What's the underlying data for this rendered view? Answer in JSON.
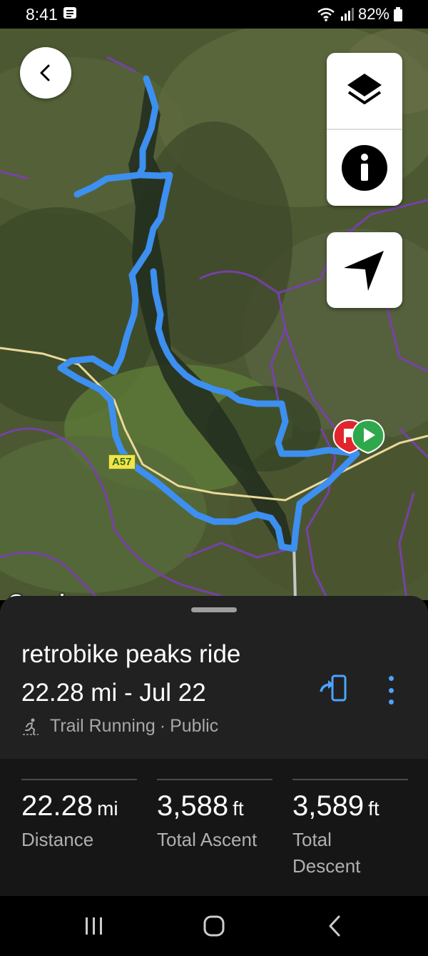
{
  "status_bar": {
    "time": "8:41",
    "battery": "82%"
  },
  "map": {
    "google_logo": "Google",
    "road_label": "A57",
    "route_color": "#3d8ff0",
    "boundary_color": "#7b3fb5"
  },
  "activity": {
    "title": "retrobike peaks ride",
    "subtitle": "22.28 mi - Jul 22",
    "type": "Trail Running",
    "separator": "·",
    "visibility": "Public"
  },
  "stats": [
    {
      "value": "22.28",
      "unit": "mi",
      "label": "Distance"
    },
    {
      "value": "3,588",
      "unit": "ft",
      "label": "Total Ascent"
    },
    {
      "value": "3,589",
      "unit": "ft",
      "label": "Total Descent"
    }
  ],
  "icons": {
    "back": "back-arrow-icon",
    "layers": "layers-icon",
    "info": "info-icon",
    "locate": "navigation-arrow-icon",
    "share": "send-to-device-icon",
    "more": "more-vertical-icon"
  },
  "colors": {
    "accent": "#4da3ff",
    "sheet_bg": "#212121",
    "stats_bg": "#161616"
  }
}
